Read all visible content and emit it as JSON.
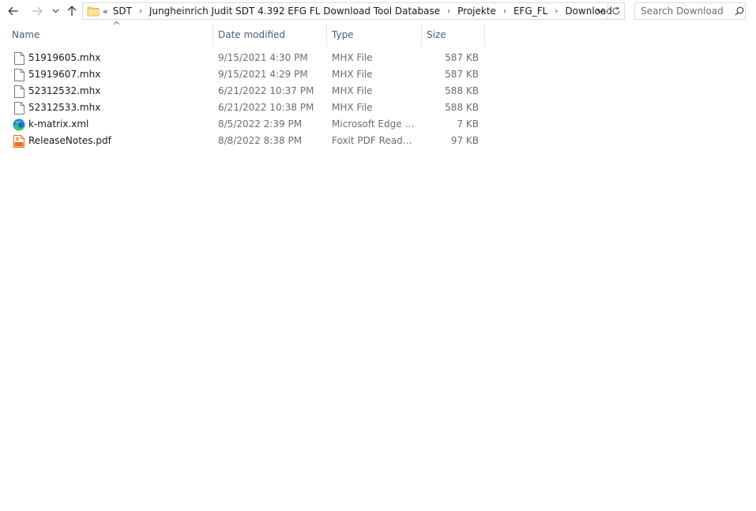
{
  "nav": {
    "back_icon": "arrow-left-icon",
    "forward_icon": "arrow-right-icon",
    "recent_icon": "chevron-down-icon",
    "up_icon": "arrow-up-icon"
  },
  "address": {
    "overflow": "«",
    "crumbs": [
      "SDT",
      "Jungheinrich Judit SDT 4.392 EFG FL Download Tool Database",
      "Projekte",
      "EFG_FL",
      "Download"
    ],
    "folder_color": "#f8d775"
  },
  "search": {
    "placeholder": "Search Download"
  },
  "columns": {
    "name": "Name",
    "date": "Date modified",
    "type": "Type",
    "size": "Size"
  },
  "files": [
    {
      "name": "51919605.mhx",
      "date": "9/15/2021 4:30 PM",
      "type": "MHX File",
      "size": "587 KB",
      "icon": "blank-file-icon"
    },
    {
      "name": "51919607.mhx",
      "date": "9/15/2021 4:29 PM",
      "type": "MHX File",
      "size": "587 KB",
      "icon": "blank-file-icon"
    },
    {
      "name": "52312532.mhx",
      "date": "6/21/2022 10:37 PM",
      "type": "MHX File",
      "size": "588 KB",
      "icon": "blank-file-icon"
    },
    {
      "name": "52312533.mhx",
      "date": "6/21/2022 10:38 PM",
      "type": "MHX File",
      "size": "588 KB",
      "icon": "blank-file-icon"
    },
    {
      "name": "k-matrix.xml",
      "date": "8/5/2022 2:39 PM",
      "type": "Microsoft Edge H...",
      "size": "7 KB",
      "icon": "edge-icon"
    },
    {
      "name": "ReleaseNotes.pdf",
      "date": "8/8/2022 8:38 PM",
      "type": "Foxit PDF Reader ...",
      "size": "97 KB",
      "icon": "pdf-icon"
    }
  ],
  "colors": {
    "header_text": "#4c607a",
    "secondary_text": "#6d6d6d",
    "pdf_orange": "#e8701a",
    "edge_blue": "#1b8ad6",
    "edge_green": "#3cc26b"
  }
}
